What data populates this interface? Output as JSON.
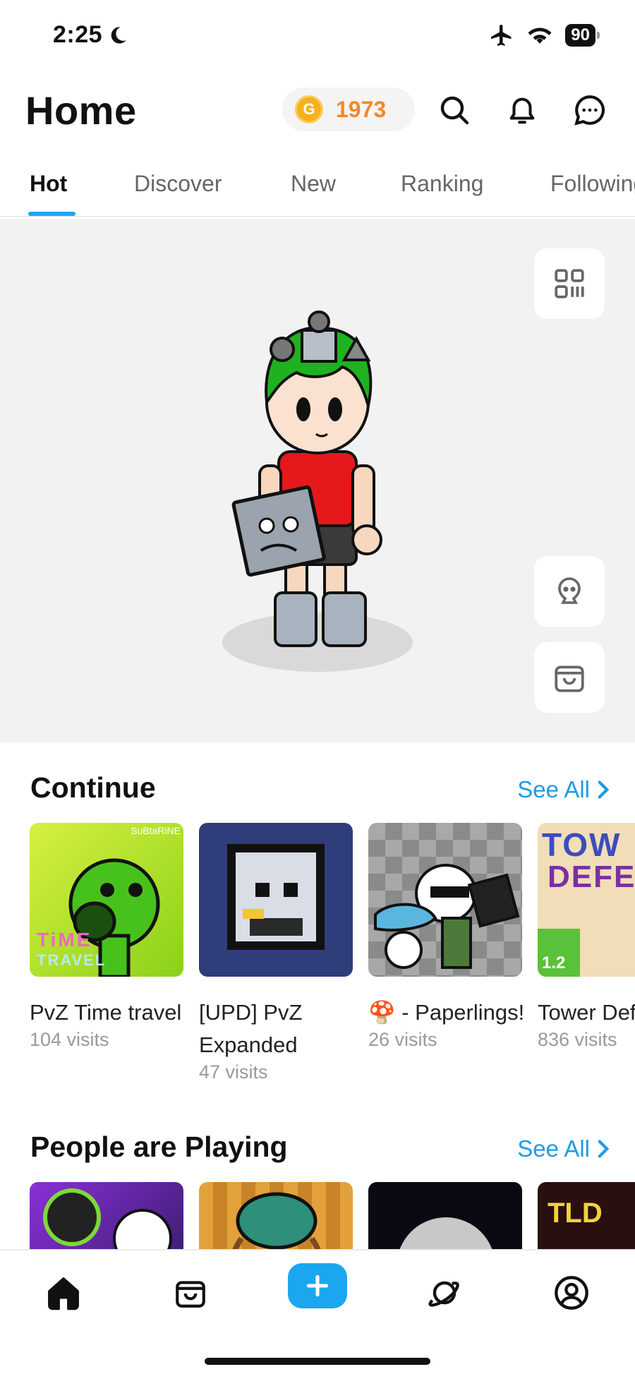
{
  "status_bar": {
    "time": "2:25",
    "battery": "90"
  },
  "header": {
    "title": "Home",
    "coins": "1973"
  },
  "tabs": [
    {
      "label": "Hot",
      "active": true
    },
    {
      "label": "Discover"
    },
    {
      "label": "New"
    },
    {
      "label": "Ranking"
    },
    {
      "label": "Following"
    }
  ],
  "continue": {
    "title": "Continue",
    "see_all": "See All",
    "items": [
      {
        "title": "PvZ Time travel",
        "visits": "104 visits"
      },
      {
        "title": "[UPD] PvZ Expanded",
        "visits": "47 visits"
      },
      {
        "title": "🍄 - Paperlings!",
        "visits": "26 visits"
      },
      {
        "title": "Tower Defense:",
        "visits": "836 visits"
      }
    ]
  },
  "people_playing": {
    "title": "People are Playing",
    "see_all": "See All"
  },
  "thumb_text": {
    "subtarine": "SuBtaRiNE",
    "time": "TiME",
    "travel": "TRAVEL",
    "tower_line1": "TOW",
    "tower_line2": "DEFE",
    "version": "1.2",
    "play_badge": "TLD"
  },
  "colors": {
    "accent": "#1ea7ef",
    "coin": "#ee8a2a",
    "link": "#1e9be6"
  }
}
